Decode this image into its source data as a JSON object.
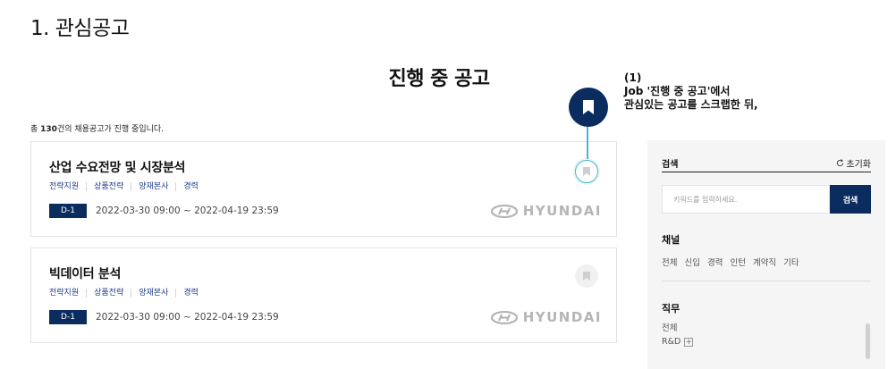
{
  "doc_heading": "1. 관심공고",
  "page_title": "진행 중 공고",
  "summary": {
    "prefix": "총 ",
    "count": "130",
    "suffix": "건의 채용공고가 진행 중입니다."
  },
  "annotation": {
    "line1": "(1)",
    "line2": "Job '진행 중 공고'에서",
    "line3": "관심있는 공고를 스크랩한 뒤,"
  },
  "postings": [
    {
      "title": "산업 수요전망 및 시장분석",
      "tags": [
        "전략지원",
        "상품전략",
        "양재본사",
        "경력"
      ],
      "dday": "D-1",
      "period": "2022-03-30 09:00 ~ 2022-04-19 23:59",
      "company_logo": "HYUNDAI",
      "bookmarked": true
    },
    {
      "title": "빅데이터 분석",
      "tags": [
        "전략지원",
        "상품전략",
        "양재본사",
        "경력"
      ],
      "dday": "D-1",
      "period": "2022-03-30 09:00 ~ 2022-04-19 23:59",
      "company_logo": "HYUNDAI",
      "bookmarked": false
    }
  ],
  "filter": {
    "search_label": "검색",
    "reset_label": "초기화",
    "search_placeholder": "키워드를 입력하세요.",
    "search_button": "검색",
    "channel_title": "채널",
    "channels": [
      "전체",
      "신입",
      "경력",
      "인턴",
      "계약직",
      "기타"
    ],
    "job_title": "직무",
    "jobs": [
      "전체",
      "R&D"
    ]
  },
  "colors": {
    "navy": "#0b2c5f",
    "accent_cyan": "#49b6c9",
    "tag_blue": "#1f3d8c"
  }
}
